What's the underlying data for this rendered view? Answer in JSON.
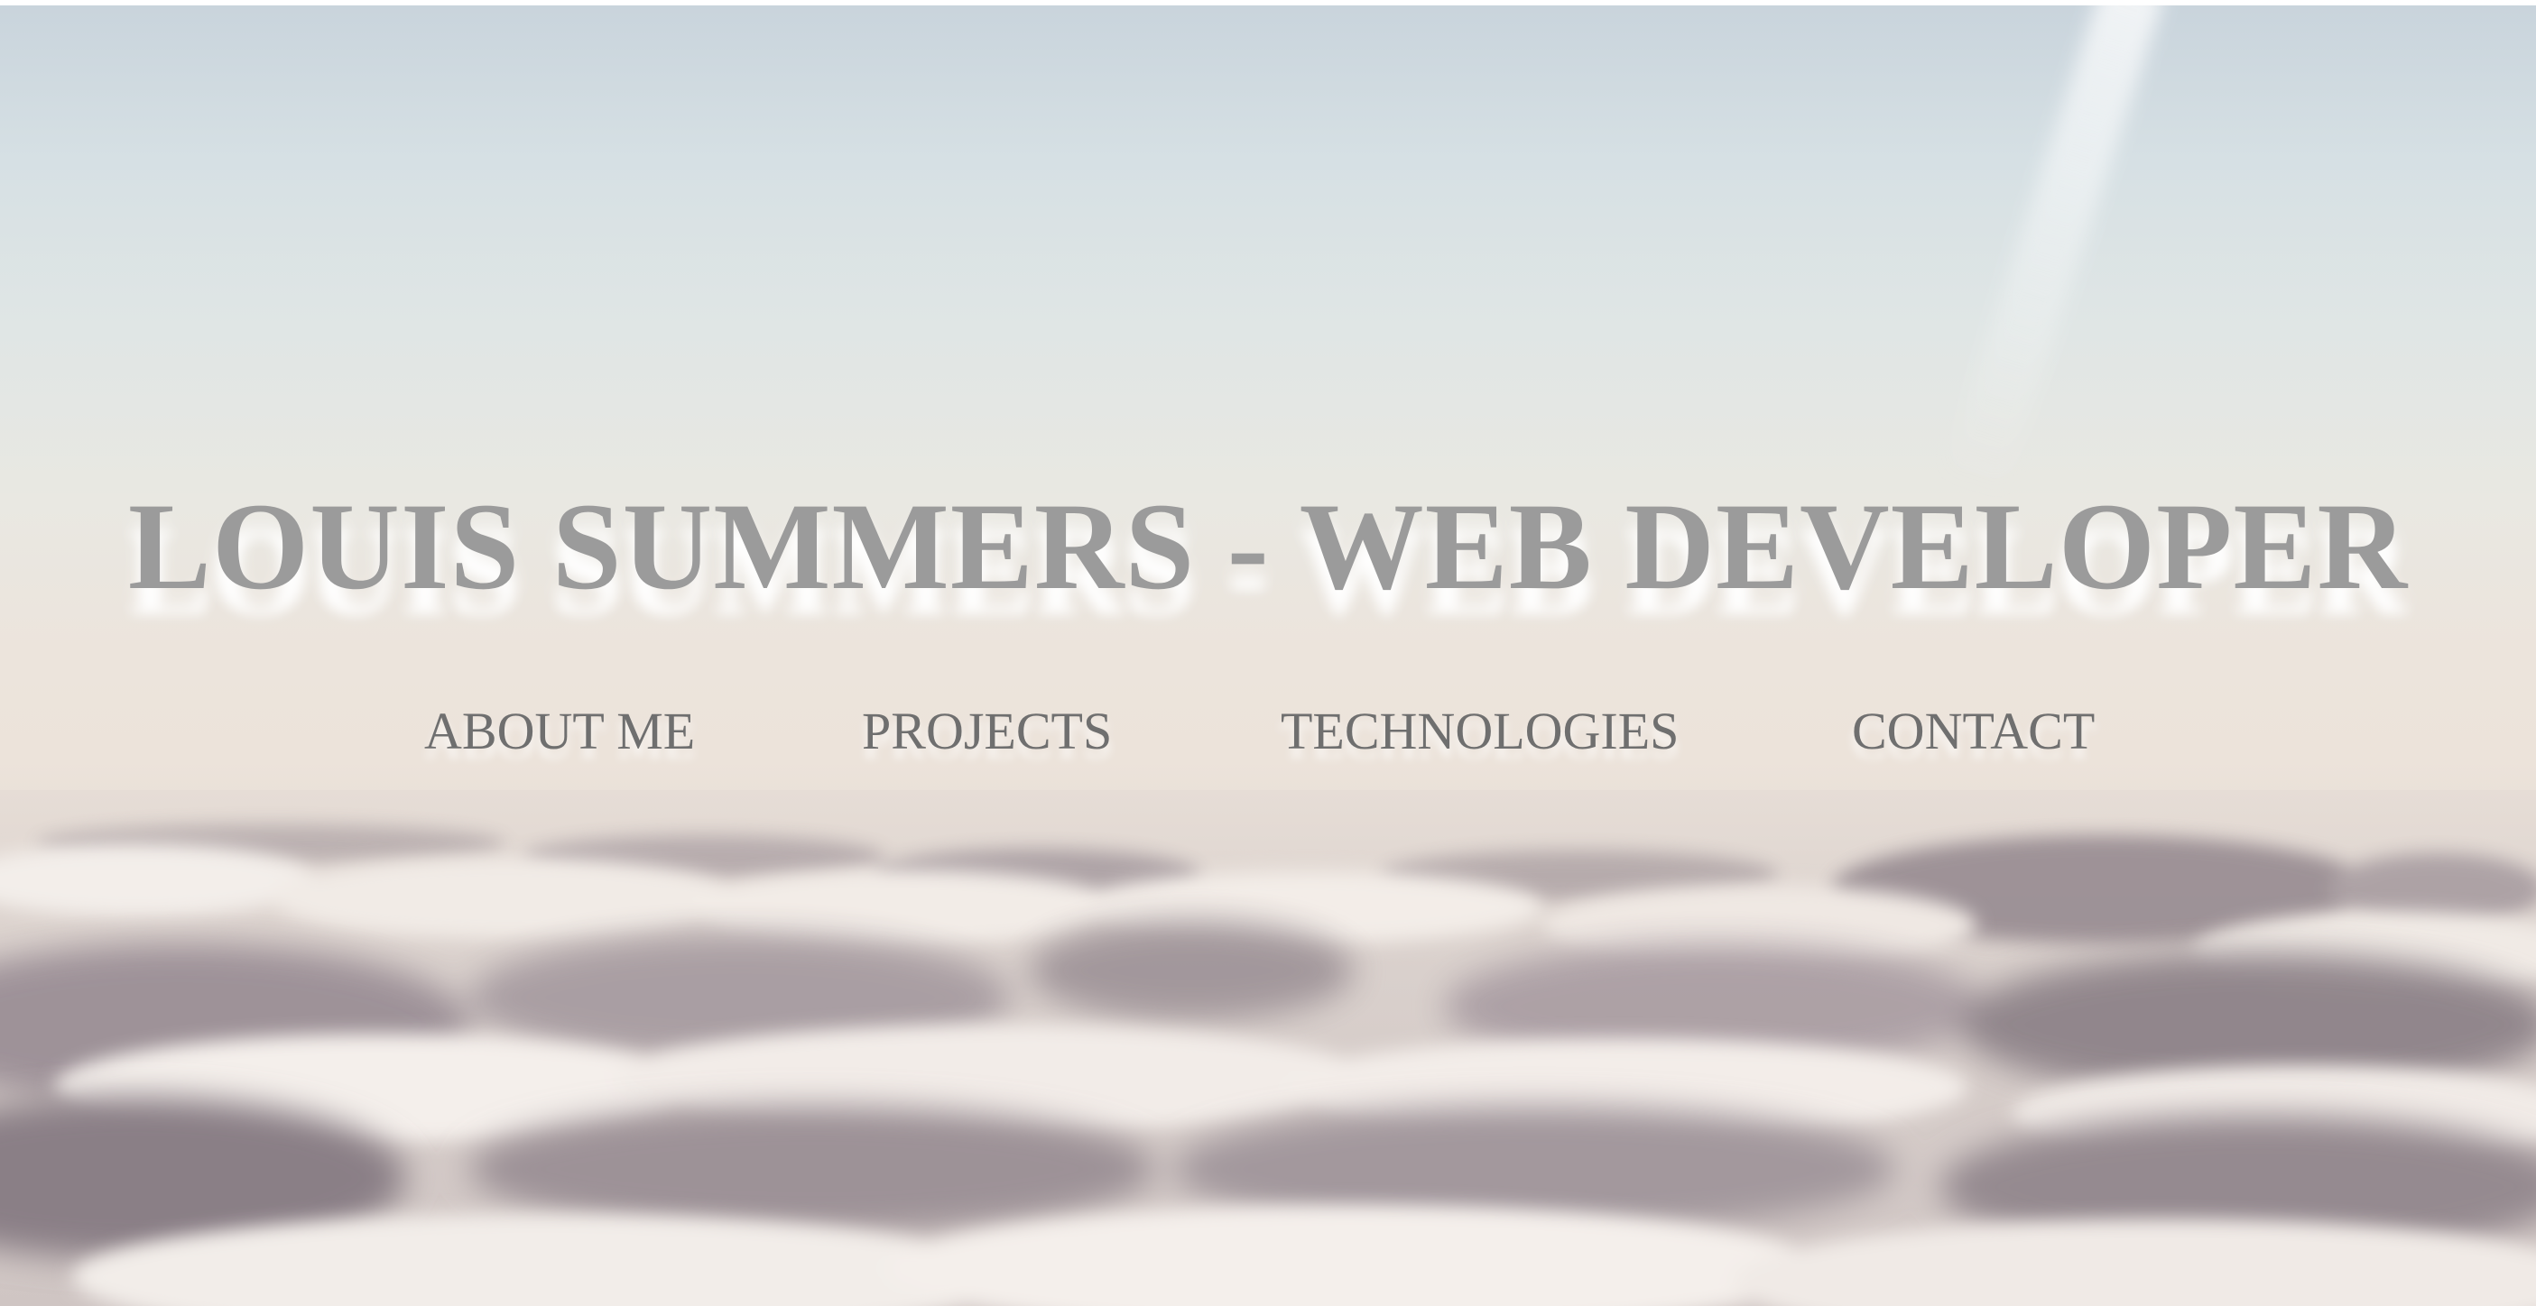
{
  "header": {
    "title": "LOUIS SUMMERS - WEB DEVELOPER"
  },
  "nav": {
    "items": [
      {
        "label": "ABOUT ME"
      },
      {
        "label": "PROJECTS"
      },
      {
        "label": "TECHNOLOGIES"
      },
      {
        "label": "CONTACT"
      }
    ]
  },
  "colors": {
    "title": "#9b9b9b",
    "nav": "#6f6f6f",
    "sky_top": "#c9d4dc",
    "horizon": "#ece3da",
    "cloud_shadow": "#9a8f95",
    "cloud_light": "#f3eeea"
  }
}
